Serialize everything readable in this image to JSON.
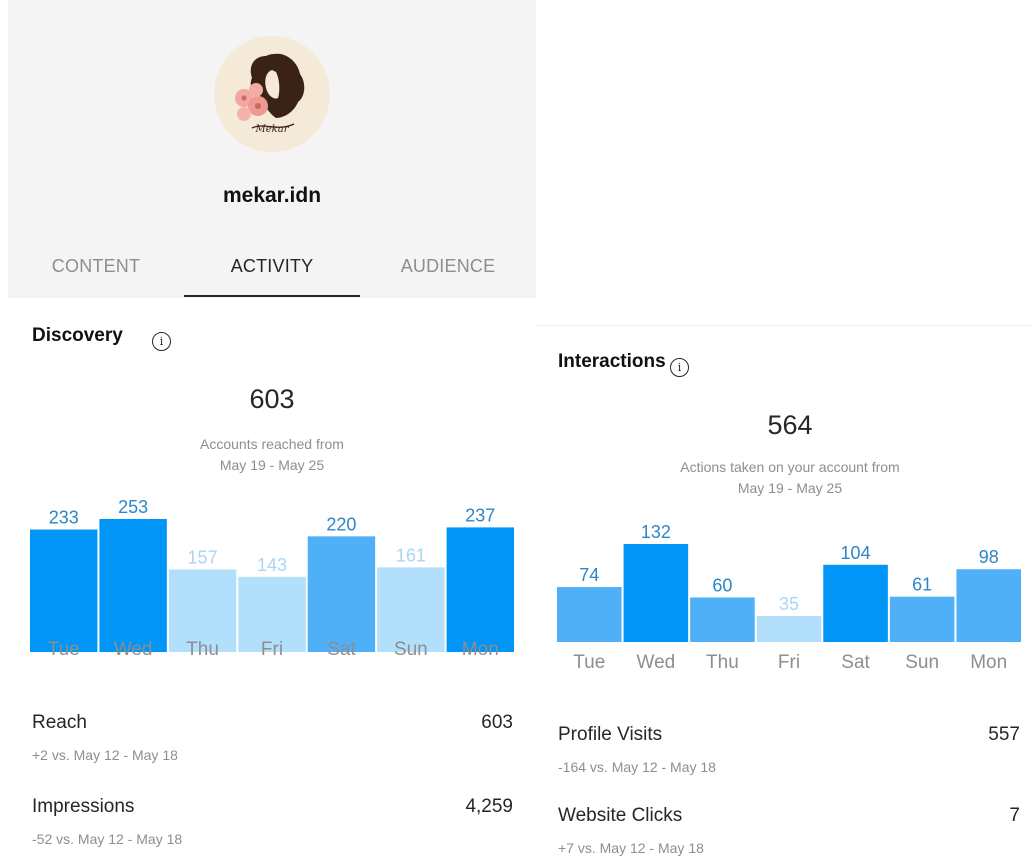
{
  "profile": {
    "username": "mekar.idn",
    "avatar_logo_text": "Mekar"
  },
  "tabs": [
    {
      "label": "CONTENT",
      "active": false
    },
    {
      "label": "ACTIVITY",
      "active": true
    },
    {
      "label": "AUDIENCE",
      "active": false
    }
  ],
  "discovery": {
    "title": "Discovery",
    "total": "603",
    "caption_line1": "Accounts reached from",
    "caption_line2": "May 19 - May 25",
    "metrics": [
      {
        "label": "Reach",
        "value": "603",
        "compare": "+2 vs. May 12 - May 18"
      },
      {
        "label": "Impressions",
        "value": "4,259",
        "compare": "-52 vs. May 12 - May 18"
      }
    ]
  },
  "interactions": {
    "title": "Interactions",
    "total": "564",
    "caption_line1": "Actions taken on your account from",
    "caption_line2": "May 19 - May 25",
    "metrics": [
      {
        "label": "Profile Visits",
        "value": "557",
        "compare": "-164 vs. May 12 - May 18"
      },
      {
        "label": "Website Clicks",
        "value": "7",
        "compare": "+7 vs. May 12 - May 18"
      }
    ]
  },
  "colors": {
    "bar_dark": "#0095f6",
    "bar_mid": "#4fb0f8",
    "bar_light": "#b2dffc",
    "label_dark": "#2d86c9",
    "label_light": "#a9d6f5",
    "day_label": "#8e8e8e"
  },
  "chart_data": [
    {
      "type": "bar",
      "categories": [
        "Tue",
        "Wed",
        "Thu",
        "Fri",
        "Sat",
        "Sun",
        "Mon"
      ],
      "values": [
        233,
        253,
        157,
        143,
        220,
        161,
        237
      ],
      "bar_shades": [
        "dark",
        "dark",
        "light",
        "light",
        "mid",
        "light",
        "dark"
      ],
      "ylim": [
        0,
        253
      ]
    },
    {
      "type": "bar",
      "categories": [
        "Tue",
        "Wed",
        "Thu",
        "Fri",
        "Sat",
        "Sun",
        "Mon"
      ],
      "values": [
        74,
        132,
        60,
        35,
        104,
        61,
        98
      ],
      "bar_shades": [
        "mid",
        "dark",
        "mid",
        "light",
        "dark",
        "mid",
        "mid"
      ],
      "ylim": [
        0,
        132
      ]
    }
  ]
}
